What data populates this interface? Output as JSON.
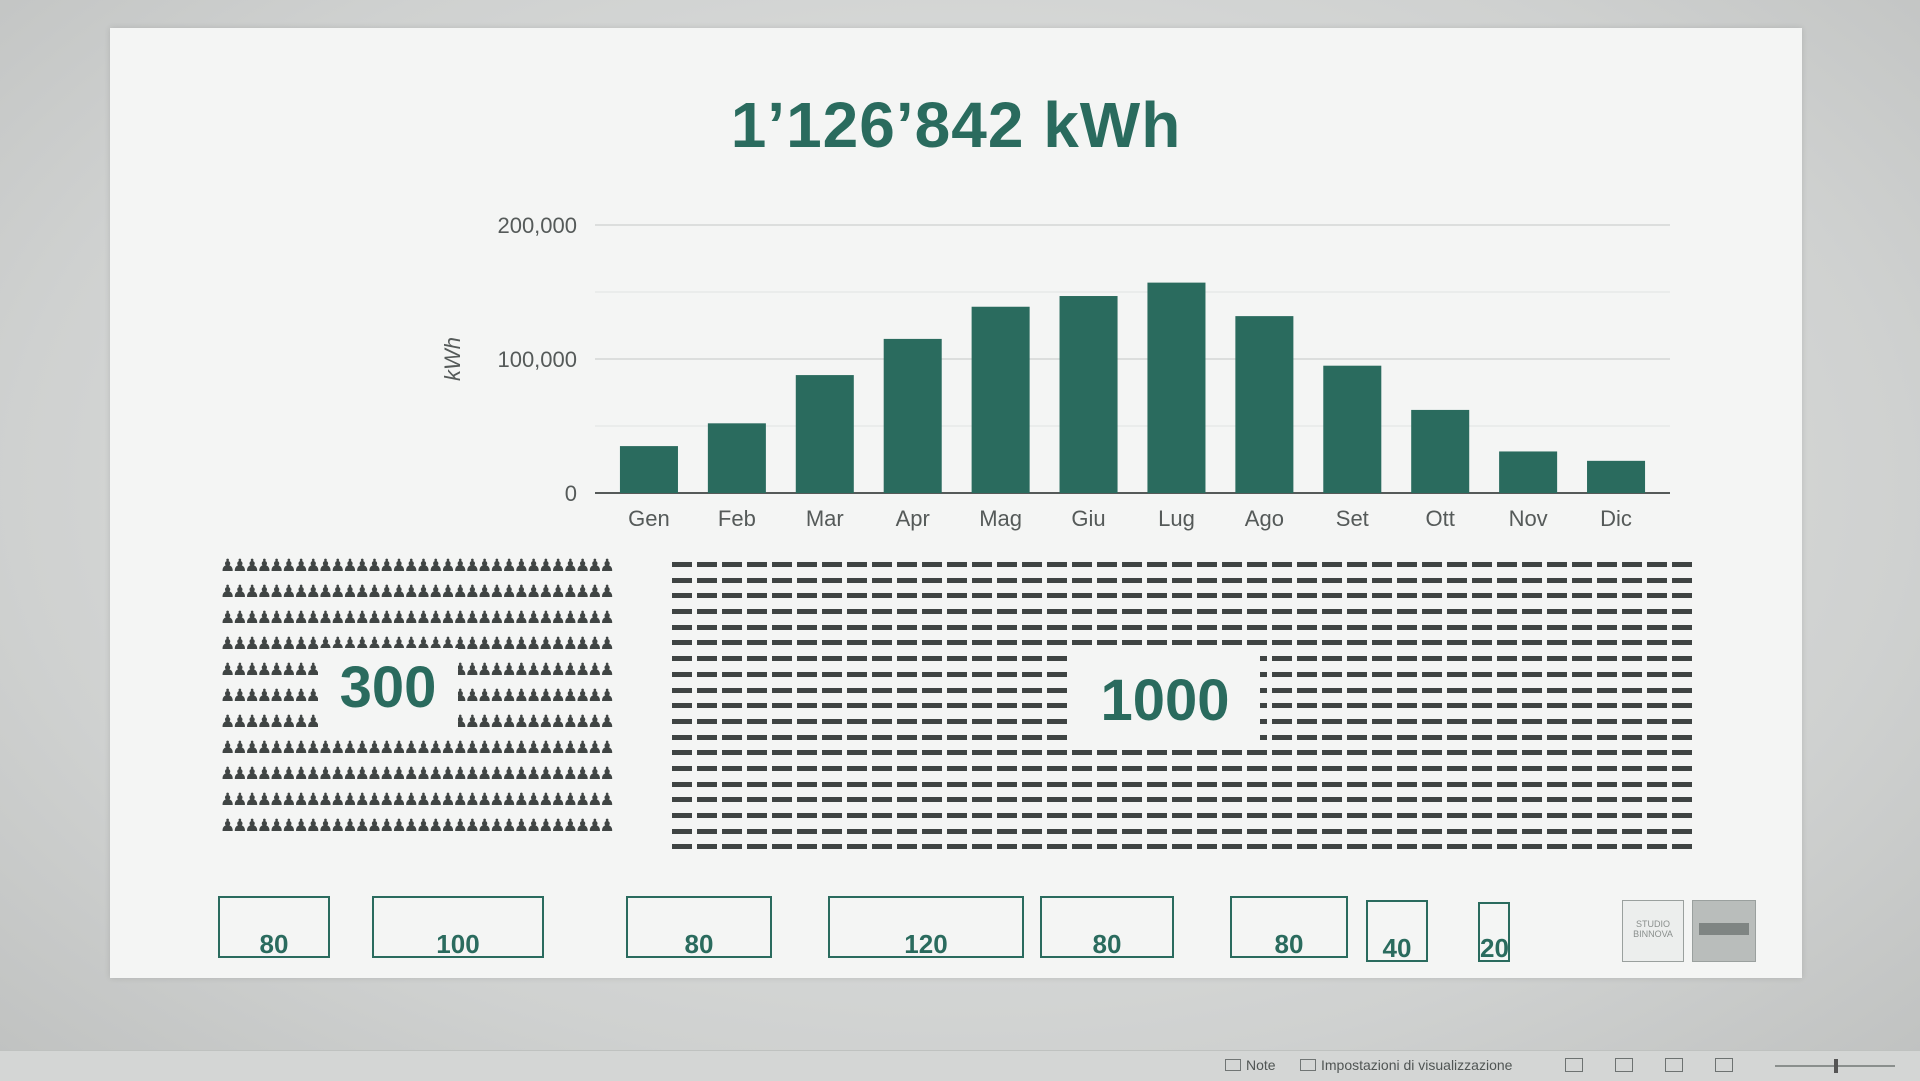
{
  "slide": {
    "title": "1’126’842 kWh",
    "people_count": "300",
    "cars_count": "1000",
    "boxes": [
      "80",
      "100",
      "80",
      "120",
      "80",
      "80",
      "40",
      "20"
    ],
    "logo1_text": "STUDIO BINNOVA"
  },
  "chart_data": {
    "type": "bar",
    "categories": [
      "Gen",
      "Feb",
      "Mar",
      "Apr",
      "Mag",
      "Giu",
      "Lug",
      "Ago",
      "Set",
      "Ott",
      "Nov",
      "Dic"
    ],
    "values": [
      35000,
      52000,
      88000,
      115000,
      139000,
      147000,
      157000,
      132000,
      95000,
      62000,
      31000,
      24000
    ],
    "ylabel": "kWh",
    "ylim": [
      0,
      200000
    ],
    "yticks": [
      "0",
      "100,000",
      "200,000"
    ],
    "color": "#2a6b5e",
    "grid": true
  },
  "statusbar": {
    "note_label": "Note",
    "view_settings_label": "Impostazioni di visualizzazione"
  }
}
